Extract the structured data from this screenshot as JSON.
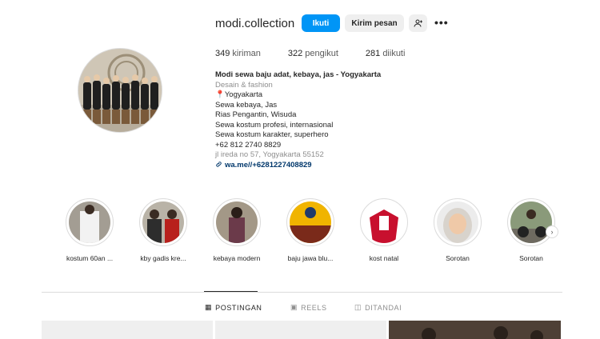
{
  "profile": {
    "username": "modi.collection",
    "follow_label": "Ikuti",
    "message_label": "Kirim pesan",
    "add_user_icon": "add-user-icon",
    "more_icon": "more-horizontal-icon"
  },
  "stats": {
    "posts_count": "349",
    "posts_label": "kiriman",
    "followers_count": "322",
    "followers_label": "pengikut",
    "following_count": "281",
    "following_label": "diikuti"
  },
  "bio": {
    "name": "Modi sewa baju adat, kebaya, jas - Yogyakarta",
    "category": "Desain & fashion",
    "lines": [
      "📍Yogyakarta",
      "Sewa kebaya, Jas",
      "Rias Pengantin, Wisuda",
      "Sewa kostum profesi, internasional",
      "Sewa kostum karakter, superhero",
      "+62 812 2740 8829"
    ],
    "address": "jl ireda no 57, Yogyakarta 55152",
    "link": "wa.me//+6281227408829"
  },
  "highlights": [
    {
      "label": "kostum 60an ..."
    },
    {
      "label": "kby gadis kre..."
    },
    {
      "label": "kebaya modern"
    },
    {
      "label": "baju jawa blu..."
    },
    {
      "label": "kost natal"
    },
    {
      "label": "Sorotan"
    },
    {
      "label": "Sorotan"
    }
  ],
  "tabs": [
    {
      "label": "POSTINGAN",
      "icon": "grid-icon"
    },
    {
      "label": "REELS",
      "icon": "reels-icon"
    },
    {
      "label": "DITANDAI",
      "icon": "tagged-icon"
    }
  ],
  "colors": {
    "accent": "#0095f6",
    "link": "#00376b"
  }
}
